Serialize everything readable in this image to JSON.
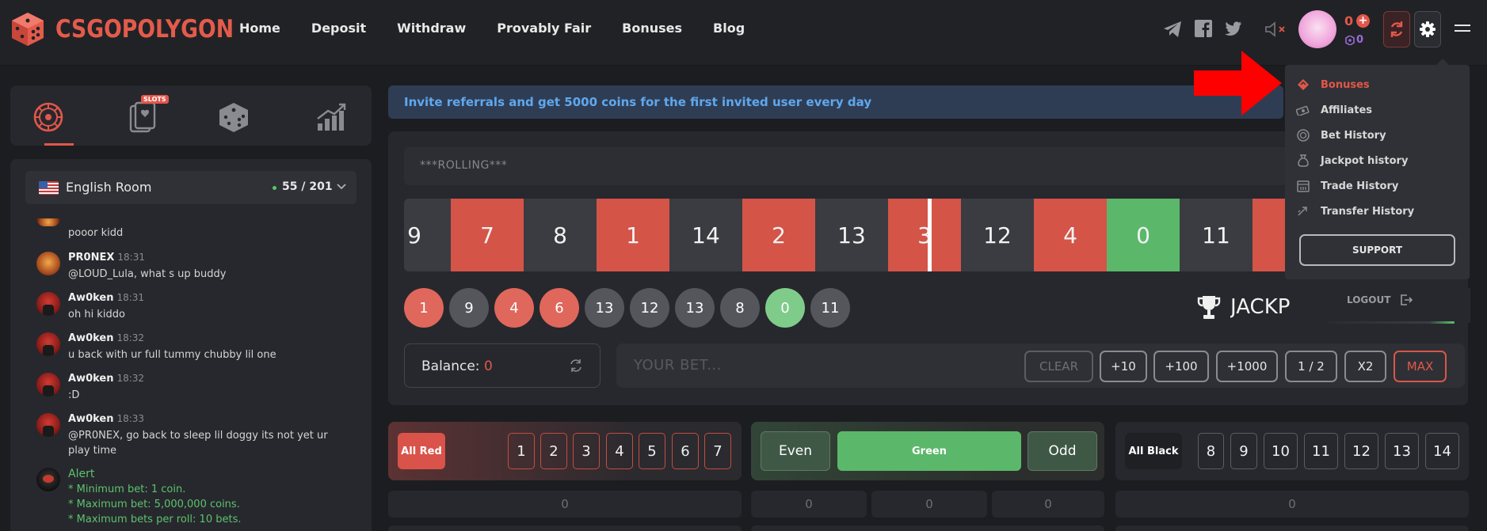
{
  "brand": {
    "name": "CSGOPOLYGON",
    "accent": "#e45b4b"
  },
  "nav": [
    "Home",
    "Deposit",
    "Withdraw",
    "Provably Fair",
    "Bonuses",
    "Blog"
  ],
  "header": {
    "social_icons": [
      "telegram-icon",
      "facebook-icon",
      "twitter-icon"
    ],
    "sound_icon": "speaker-muted-icon",
    "balance": "0",
    "gems": "0"
  },
  "game_tabs": [
    {
      "icon": "roulette-icon",
      "active": true
    },
    {
      "icon": "slots-icon",
      "badge": "SLOTS"
    },
    {
      "icon": "dice-icon"
    },
    {
      "icon": "crash-chart-icon"
    }
  ],
  "chat": {
    "room": {
      "name": "English Room",
      "count": "55 / 201"
    },
    "messages": [
      {
        "text": "pooor kidd"
      },
      {
        "user": "PR0NEX",
        "time": "18:31",
        "text": "@LOUD_Lula, what s up buddy"
      },
      {
        "user": "Aw0ken",
        "time": "18:31",
        "text": "oh hi kiddo"
      },
      {
        "user": "Aw0ken",
        "time": "18:32",
        "text": "u back with ur full tummy chubby lil one"
      },
      {
        "user": "Aw0ken",
        "time": "18:32",
        "text": ":D"
      },
      {
        "user": "Aw0ken",
        "time": "18:33",
        "text": "@PR0NEX, go back to sleep lil doggy its not yet ur play time"
      }
    ],
    "alert": {
      "title": "Alert",
      "lines": [
        "* Minimum bet: 1 coin.",
        "* Maximum bet: 5,000,000 coins.",
        "* Maximum bets per roll: 10 bets."
      ]
    }
  },
  "banner": "Invite referrals and get 5000 coins for the first invited user every day",
  "roulette": {
    "status": "***ROLLING***",
    "strip": [
      {
        "n": "9",
        "c": "black"
      },
      {
        "n": "7",
        "c": "red"
      },
      {
        "n": "8",
        "c": "black"
      },
      {
        "n": "1",
        "c": "red"
      },
      {
        "n": "14",
        "c": "black"
      },
      {
        "n": "2",
        "c": "red"
      },
      {
        "n": "13",
        "c": "black"
      },
      {
        "n": "3",
        "c": "red"
      },
      {
        "n": "12",
        "c": "black"
      },
      {
        "n": "4",
        "c": "red"
      },
      {
        "n": "0",
        "c": "green"
      },
      {
        "n": "11",
        "c": "black"
      },
      {
        "n": "",
        "c": "red"
      }
    ],
    "history": [
      {
        "n": "1",
        "c": "red"
      },
      {
        "n": "9",
        "c": "black"
      },
      {
        "n": "4",
        "c": "red"
      },
      {
        "n": "6",
        "c": "red"
      },
      {
        "n": "13",
        "c": "black"
      },
      {
        "n": "12",
        "c": "black"
      },
      {
        "n": "13",
        "c": "black"
      },
      {
        "n": "8",
        "c": "black"
      },
      {
        "n": "0",
        "c": "green"
      },
      {
        "n": "11",
        "c": "black"
      }
    ],
    "jackpot_label": "JACKPOT"
  },
  "bet": {
    "balance_label": "Balance:",
    "balance_value": "0",
    "placeholder": "YOUR BET...",
    "buttons": [
      "CLEAR",
      "+10",
      "+100",
      "+1000",
      "1 / 2",
      "X2",
      "MAX"
    ]
  },
  "bet_areas": {
    "red": {
      "label": "All Red",
      "numbers": [
        "1",
        "2",
        "3",
        "4",
        "5",
        "6",
        "7"
      ]
    },
    "green": {
      "even": "Even",
      "green": "Green",
      "odd": "Odd"
    },
    "black": {
      "label": "All Black",
      "numbers": [
        "8",
        "9",
        "10",
        "11",
        "12",
        "13",
        "14"
      ]
    },
    "totals": [
      "0",
      "0",
      "0",
      "0",
      "0"
    ]
  },
  "dropdown": {
    "items": [
      {
        "label": "Bonuses",
        "icon": "ticket-icon",
        "active": true
      },
      {
        "label": "Affiliates",
        "icon": "money-icon"
      },
      {
        "label": "Bet History",
        "icon": "chip-icon"
      },
      {
        "label": "Jackpot history",
        "icon": "moneybag-icon"
      },
      {
        "label": "Trade History",
        "icon": "calendar-icon"
      },
      {
        "label": "Transfer History",
        "icon": "transfer-icon"
      }
    ],
    "support": "SUPPORT",
    "logout": "LOGOUT"
  }
}
